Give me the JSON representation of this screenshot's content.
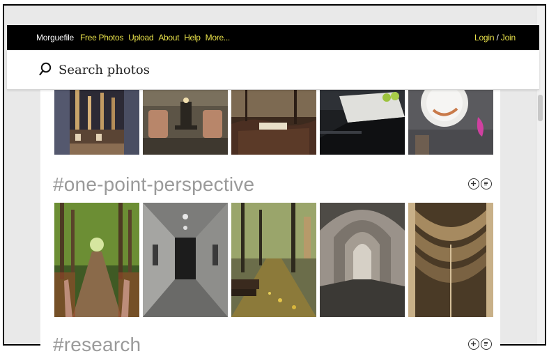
{
  "nav": {
    "brand": "Morguefile",
    "links": [
      "Free Photos",
      "Upload",
      "About",
      "Help",
      "More..."
    ],
    "login": "Login",
    "slash": "/",
    "join": "Join"
  },
  "search": {
    "placeholder": "Search photos"
  },
  "sections": [
    {
      "title": "#one-point-perspective"
    },
    {
      "title": "#research"
    }
  ],
  "icons": [
    "search-icon",
    "add-circle-icon",
    "comment-circle-icon"
  ],
  "colors": {
    "topbar": "#000000",
    "nav_link": "#e7e04a",
    "section_title": "#9a9a9a"
  }
}
